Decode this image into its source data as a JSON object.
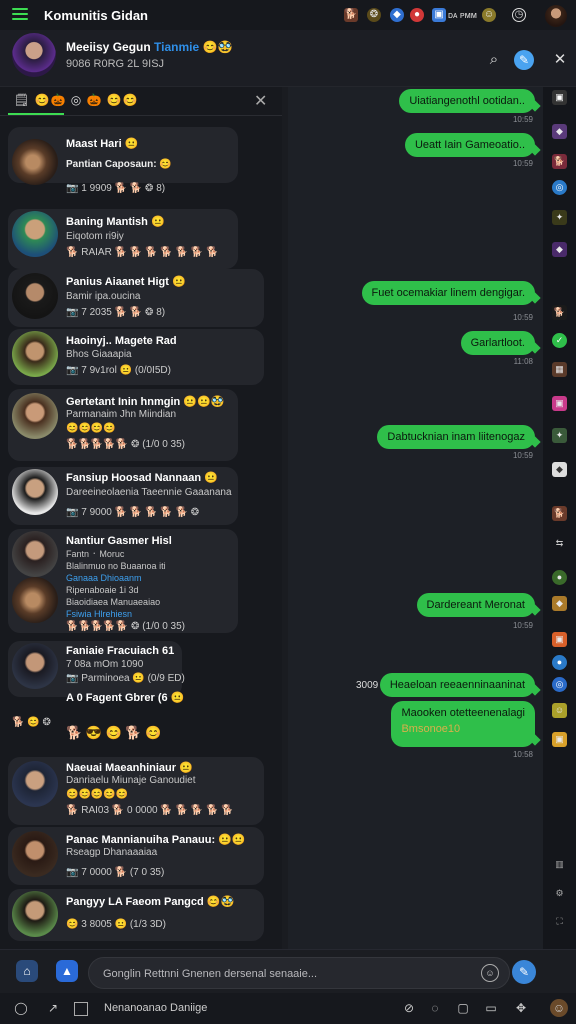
{
  "topbar": {
    "app_title": "Komunitis Gidan",
    "status_text": "ᴅᴀ ᴘᴍᴍ"
  },
  "chat_header": {
    "name_prefix": "Meeiisy Gegun",
    "name_highlight": "Tianmie",
    "name_emoji": "😊🥸",
    "subtitle": "9086 R0RG 2L 9ISJ"
  },
  "panel": {
    "tab_chips": "🗒 😊🎃 ◎ 🎃 😊😊",
    "close_icon": "✕"
  },
  "conversations": [
    {
      "name": "Maast Hari 😐",
      "line2": "Pantian Caposaun: 😊",
      "meta": "📷 1 9909 🐕 🐕 ❂ 8)"
    },
    {
      "name": "Baning Mantish 😐",
      "line2": "Eiqotom ri9iy",
      "meta": "🐕 RAIAR 🐕 🐕 🐕 🐕 🐕 🐕 🐕"
    },
    {
      "name": "Panius Aiaanet Higt 😐",
      "line2": "Bamir ipa.oucina",
      "meta": "📷 7 2035 🐕 🐕 ❂ 8)"
    },
    {
      "name": "Haoinyj.. Magete Rad",
      "line2": "Bhos Giaaapia",
      "meta": "📷 7 9v1rol 😐 (0/0I5D)"
    },
    {
      "name": "Gertetant Inin hnmgin 😐😐🥸",
      "line2": "Parmanaim Jhn Miindian",
      "emojis": "😊😊😊😊",
      "meta": "🐕🐕🐕🐕🐕 ❂ (1/0 0 35)"
    },
    {
      "name": "Fansiup Hoosad Nannaan 😐",
      "line2": "Dareeineolaenia Taeennie Gaaanana",
      "meta": "📷 7 9000 🐕 🐕 🐕 🐕 🐕 ❂"
    },
    {
      "name": "Nantiur Gasmer Hisl",
      "line2": "Fantn ᛫ Moruc",
      "line3": "Blalinmuo no Buaanoa iti",
      "line4": "Ganaaa Dhioaanm",
      "line5": "Ripenaboaie 1i 3d",
      "line6": "Biaoidiaea Manuaeaiao",
      "blue": "Fsiwia Hlrehiesn",
      "meta": "🐕🐕🐕🐕🐕 ❂ (1/0 0 35)"
    },
    {
      "name": "Faniaie Fracuiach 61",
      "line2": "7 08a mOm 1090",
      "meta": "📷 Parminoea 😐 (0/9 ED)"
    },
    {
      "standalone": "A 0 Fagent Gbrer (6 😐"
    },
    {
      "name": "Naeuai Maeanhiniaur 😐",
      "line2": "Danriaelu Miunaje Ganoudiet",
      "emojis": "😊😊😊😊😊",
      "meta": "🐕 RAI03 🐕 0 0000 🐕 🐕 🐕 🐕 🐕"
    },
    {
      "name": "Panac Mannianuiha Panauu: 😐😐",
      "line2": "Rseagp  Dhanaaaiaa",
      "meta": "📷 7 0000 🐕 (7 0 35)"
    },
    {
      "name": "Pangyy LA Faeom Pangcd 😊🥸",
      "line2": "",
      "meta": "😊 3 8005 😐 (1/3 3D)"
    }
  ],
  "react_row_left": "🐕 😊 ❂",
  "react_row_emojis": "🐕 😎 😊 🐕 😊",
  "messages": [
    {
      "text": "Uiatiangenothl ootidan..",
      "time": "10:59"
    },
    {
      "text": "Ueatt Iain Gameoatio..",
      "time": "10:59"
    },
    {
      "text": "Fuet ocemakiar linem dengigar.",
      "time": "10:59"
    },
    {
      "text": "Garlartloot.",
      "time": "11:08"
    },
    {
      "text": "Dabtucknian inam liitenogaz",
      "time": "10:59"
    },
    {
      "text": "Dardereant Meronat",
      "time": "10:59"
    },
    {
      "text": "Heaeloan reeaenninaaninat",
      "prefix": "3009",
      "time": ""
    },
    {
      "text": "Maooken otetteenenalagi",
      "text2": "Bmsonoe10",
      "time": "10:58"
    }
  ],
  "composer": {
    "placeholder": "Gonglin Rettnni Gnenen dersenal senaaie...",
    "emoji_label": "☺"
  },
  "bottom": {
    "label": "Nenanoanao Daniige"
  },
  "colors": {
    "accent": "#3ddc52",
    "bubble": "#2fbf4a",
    "link": "#3da0ef",
    "background": "#14161b"
  }
}
